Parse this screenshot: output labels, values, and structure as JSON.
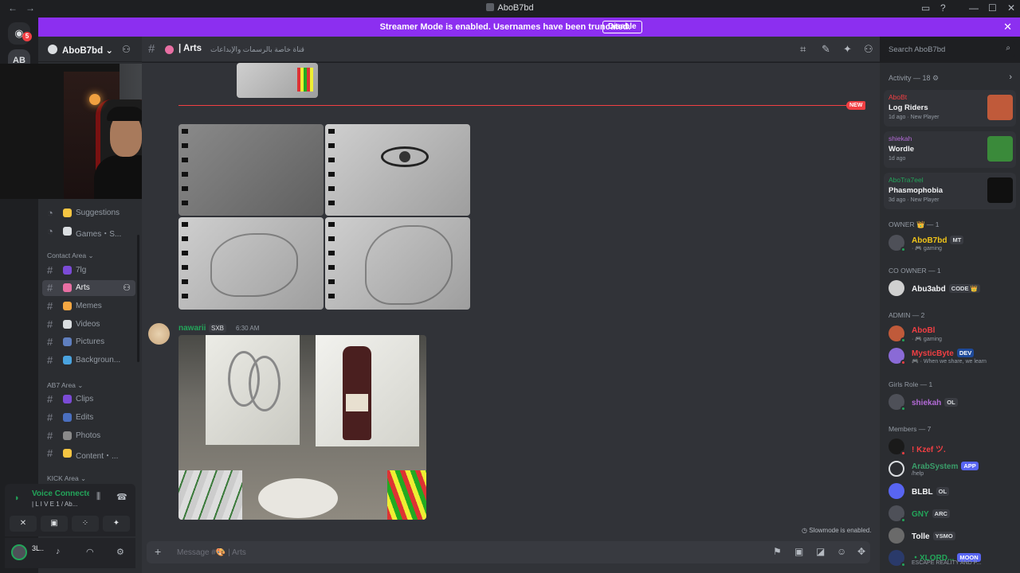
{
  "window": {
    "title": "AboB7bd",
    "back_glyph": "←",
    "forward_glyph": "→",
    "controls": [
      "▭",
      "?",
      "—",
      "☐",
      "✕"
    ]
  },
  "guilds": {
    "dm_glyph": "◉",
    "dm_badge": "5",
    "server_abbrev": "AB"
  },
  "banner": {
    "message": "Streamer Mode is enabled. Usernames have been truncated.",
    "button": "Disable",
    "close": "✕",
    "color": "#8c2ff0"
  },
  "server": {
    "name": "AboB7bd",
    "chevron": "⌄",
    "invite_icon": "add-user-icon"
  },
  "channels": [
    {
      "label": "Suggestions",
      "emoji": "#f5c542"
    },
    {
      "label": "Games・S...",
      "emoji": "#dbdee1"
    }
  ],
  "categories": {
    "contact": "Contact Area ⌄",
    "ab7": "AB7 Area ⌄",
    "kick": "KICK Area ⌄"
  },
  "contact_channels": [
    {
      "label": "7lg",
      "emoji": "#7b4bd6"
    },
    {
      "label": "Arts",
      "emoji": "#e86fa3",
      "active": true
    },
    {
      "label": "Memes",
      "emoji": "#f5a742"
    },
    {
      "label": "Videos",
      "emoji": "#dbdee1"
    },
    {
      "label": "Pictures",
      "emoji": "#5f7fbf"
    },
    {
      "label": "Backgroun...",
      "emoji": "#4aa3df"
    }
  ],
  "ab7_channels": [
    {
      "label": "Clips",
      "emoji": "#7b4bd6"
    },
    {
      "label": "Edits",
      "emoji": "#4a6fbf"
    },
    {
      "label": "Photos",
      "emoji": "#8a8a8a"
    },
    {
      "label": "Content・...",
      "emoji": "#f5c542"
    }
  ],
  "voice": {
    "status": "Voice Connected",
    "channel": "| L I V E 1 / Ab...",
    "buttons": [
      "✕",
      "▣",
      "⁘",
      "✦"
    ]
  },
  "user": {
    "name": "3L..",
    "mic": "🎙",
    "headset": "🎧",
    "settings": "⚙"
  },
  "chat": {
    "channel_name": "| Arts",
    "topic": "قناة خاصة بالرسمات والإبداعات",
    "new_label": "NEW",
    "slowmode": "Slowmode is enabled.",
    "composer_placeholder": "Message #🎨 | Arts",
    "message": {
      "author": "nawarii",
      "tag": "SXB",
      "time": "6:30 AM"
    }
  },
  "search": {
    "placeholder": "Search AboB7bd"
  },
  "activity": {
    "header": "Activity — 18 ⚙",
    "items": [
      {
        "who": "AboBt",
        "who_color": "#f23f43",
        "game": "Log Riders",
        "meta": "1d ago · New Player",
        "thumb": "#c05a3a"
      },
      {
        "who": "shiekah",
        "who_color": "#b36ad6",
        "game": "Wordle",
        "meta": "1d ago",
        "thumb": "#3a8a3a"
      },
      {
        "who": "AboTra7eel",
        "who_color": "#23a55a",
        "game": "Phasmophobia",
        "meta": "3d ago · New Player",
        "thumb": "#101010"
      }
    ]
  },
  "member_groups": [
    {
      "label": "OWNER 👑 — 1",
      "members": [
        {
          "name": "AboB7bd",
          "color": "#f0c419",
          "tag": "MT",
          "sub": "· 🎮 gaming",
          "avatar": "#4e5058"
        }
      ]
    },
    {
      "label": "CO OWNER — 1",
      "members": [
        {
          "name": "Abu3abd",
          "color": "#f2f3f5",
          "tag": "CODE 👑",
          "sub": "",
          "avatar": "#d0d0d0"
        }
      ]
    },
    {
      "label": "ADMIN — 2",
      "members": [
        {
          "name": "AboBl",
          "color": "#f23f43",
          "tag": "",
          "sub": "· 🎮 gaming",
          "avatar": "#c05a3a"
        },
        {
          "name": "MysticByte",
          "color": "#f23f43",
          "tag": "DEV",
          "sub": "🎮 · When we share, we learn",
          "avatar": "#8a6ad6"
        }
      ]
    },
    {
      "label": "Girls Role — 1",
      "members": [
        {
          "name": "shiekah",
          "color": "#b36ad6",
          "tag": "OL",
          "sub": "",
          "avatar": "#4e5058"
        }
      ]
    },
    {
      "label": "Members — 7",
      "members": [
        {
          "name": "! Kzef ツ.",
          "color": "#f23f43",
          "tag": "",
          "sub": "",
          "avatar": "#1a1a1a"
        },
        {
          "name": "ArabSystem",
          "color": "#3a9e6a",
          "tag": "APP",
          "sub": "/help",
          "avatar": "#2b2d31"
        },
        {
          "name": "BLBL",
          "color": "#f2f3f5",
          "tag": "OL",
          "sub": "",
          "avatar": "#5865f2"
        },
        {
          "name": "GNY",
          "color": "#23a55a",
          "tag": "ARC",
          "sub": "",
          "avatar": "#4e5058"
        },
        {
          "name": "Tolle",
          "color": "#f2f3f5",
          "tag": "YSMO",
          "sub": "",
          "avatar": "#6a6a6a"
        },
        {
          "name": "・XLORD...",
          "color": "#23a55a",
          "tag": "MOON",
          "sub": "ESCAPE REALITY AND P...",
          "avatar": "#2a3a6a"
        }
      ]
    }
  ]
}
